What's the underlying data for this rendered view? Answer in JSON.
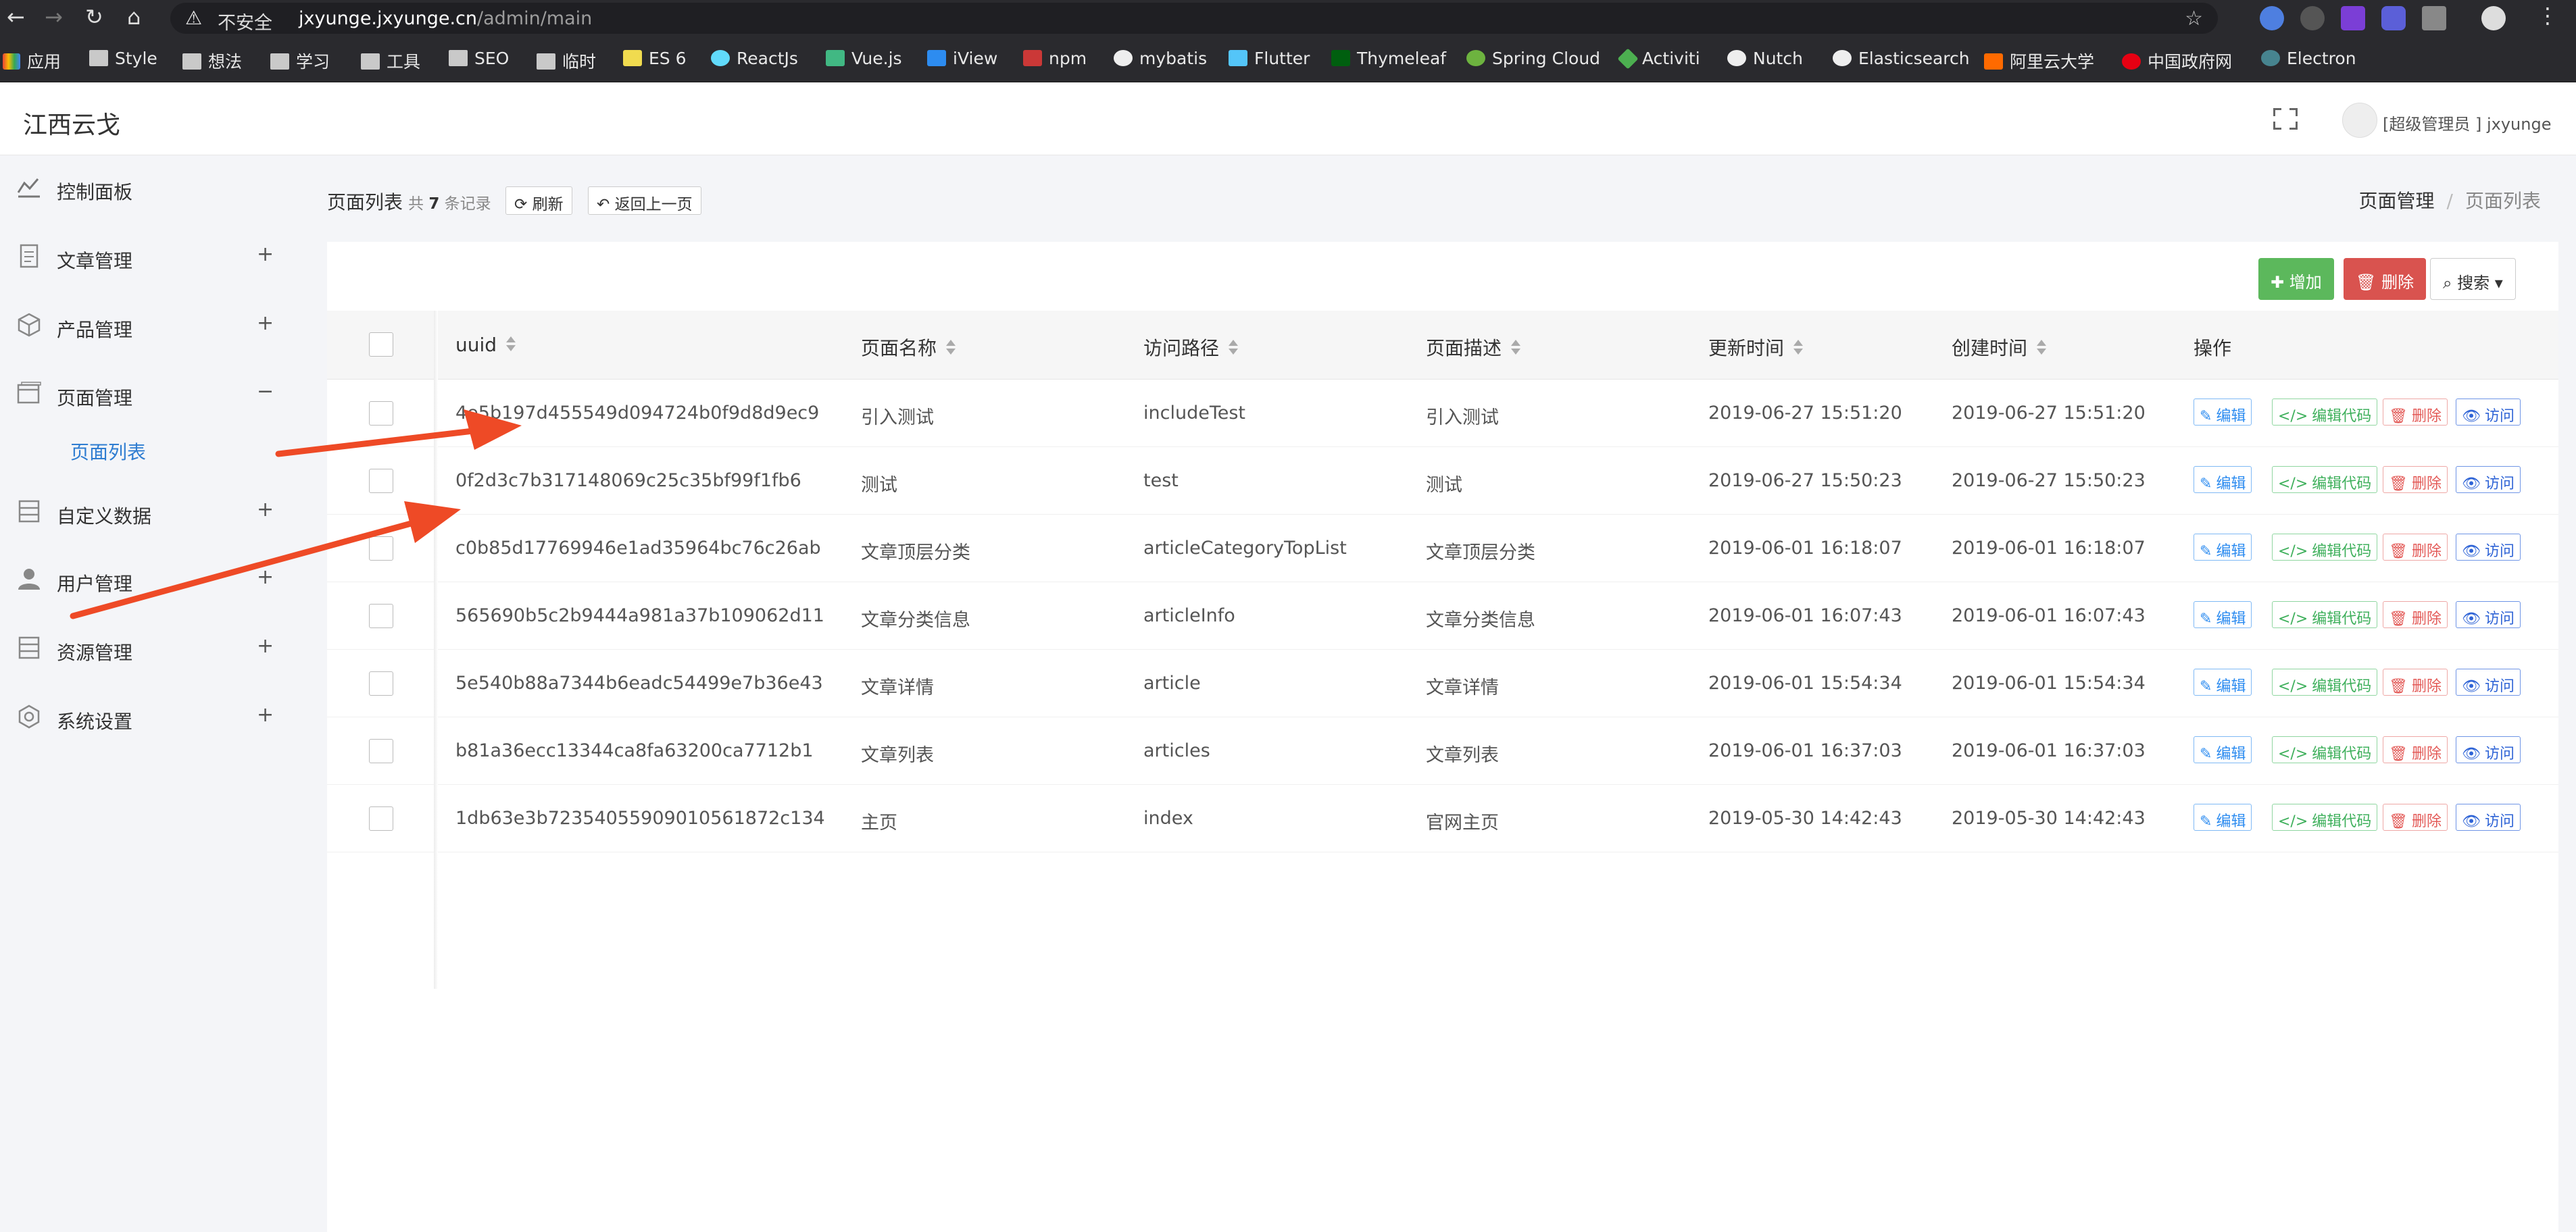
{
  "browser": {
    "security_label": "不安全",
    "url_host": "jxyunge.jxyunge.cn",
    "url_path": "/admin/main",
    "bookmarks": [
      "应用",
      "Style",
      "想法",
      "学习",
      "工具",
      "SEO",
      "临时",
      "ES 6",
      "ReactJs",
      "Vue.js",
      "iView",
      "npm",
      "mybatis",
      "Flutter",
      "Thymeleaf",
      "Spring Cloud",
      "Activiti",
      "Nutch",
      "Elasticsearch",
      "阿里云大学",
      "中国政府网",
      "Electron"
    ]
  },
  "header": {
    "brand": "江西云戈",
    "user_label": "[超级管理员 ] jxyunge"
  },
  "sidebar": {
    "items": [
      {
        "label": "控制面板",
        "icon": "dashboard-icon",
        "toggle": ""
      },
      {
        "label": "文章管理",
        "icon": "document-icon",
        "toggle": "+"
      },
      {
        "label": "产品管理",
        "icon": "cube-icon",
        "toggle": "+"
      },
      {
        "label": "页面管理",
        "icon": "window-icon",
        "toggle": "−"
      },
      {
        "label": "自定义数据",
        "icon": "database-icon",
        "toggle": "+"
      },
      {
        "label": "用户管理",
        "icon": "user-icon",
        "toggle": "+"
      },
      {
        "label": "资源管理",
        "icon": "storage-icon",
        "toggle": "+"
      },
      {
        "label": "系统设置",
        "icon": "gear-icon",
        "toggle": "+"
      }
    ],
    "active_sub": "页面列表"
  },
  "toolbar": {
    "title": "页面列表",
    "count_prefix": "共",
    "count": "7",
    "count_suffix": "条记录",
    "refresh": "刷新",
    "back": "返回上一页"
  },
  "breadcrumb": {
    "parent": "页面管理",
    "sep": "/",
    "current": "页面列表"
  },
  "actions": {
    "add": "增加",
    "delete": "删除",
    "search": "搜索"
  },
  "table": {
    "columns": [
      "uuid",
      "页面名称",
      "访问路径",
      "页面描述",
      "更新时间",
      "创建时间",
      "操作"
    ],
    "row_actions": [
      "编辑",
      "编辑代码",
      "删除",
      "访问"
    ],
    "rows": [
      [
        "4e5b197d455549d094724b0f9d8d9ec9",
        "引入测试",
        "includeTest",
        "引入测试",
        "2019-06-27 15:51:20",
        "2019-06-27 15:51:20"
      ],
      [
        "0f2d3c7b317148069c25c35bf99f1fb6",
        "测试",
        "test",
        "测试",
        "2019-06-27 15:50:23",
        "2019-06-27 15:50:23"
      ],
      [
        "c0b85d17769946e1ad35964bc76c26ab",
        "文章顶层分类",
        "articleCategoryTopList",
        "文章顶层分类",
        "2019-06-01 16:18:07",
        "2019-06-01 16:18:07"
      ],
      [
        "565690b5c2b9444a981a37b109062d11",
        "文章分类信息",
        "articleInfo",
        "文章分类信息",
        "2019-06-01 16:07:43",
        "2019-06-01 16:07:43"
      ],
      [
        "5e540b88a7344b6eadc54499e7b36e43",
        "文章详情",
        "article",
        "文章详情",
        "2019-06-01 15:54:34",
        "2019-06-01 15:54:34"
      ],
      [
        "b81a36ecc13344ca8fa63200ca7712b1",
        "文章列表",
        "articles",
        "文章列表",
        "2019-06-01 16:37:03",
        "2019-06-01 16:37:03"
      ],
      [
        "1db63e3b7235405590901056187 2c134",
        "主页",
        "index",
        "官网主页",
        "2019-05-30 14:42:43",
        "2019-05-30 14:42:43"
      ]
    ]
  },
  "colors": {
    "add": "#5cb85c",
    "delete": "#d9534f",
    "link": "#2f7dd1",
    "annotation_arrow": "#ee4a26"
  }
}
